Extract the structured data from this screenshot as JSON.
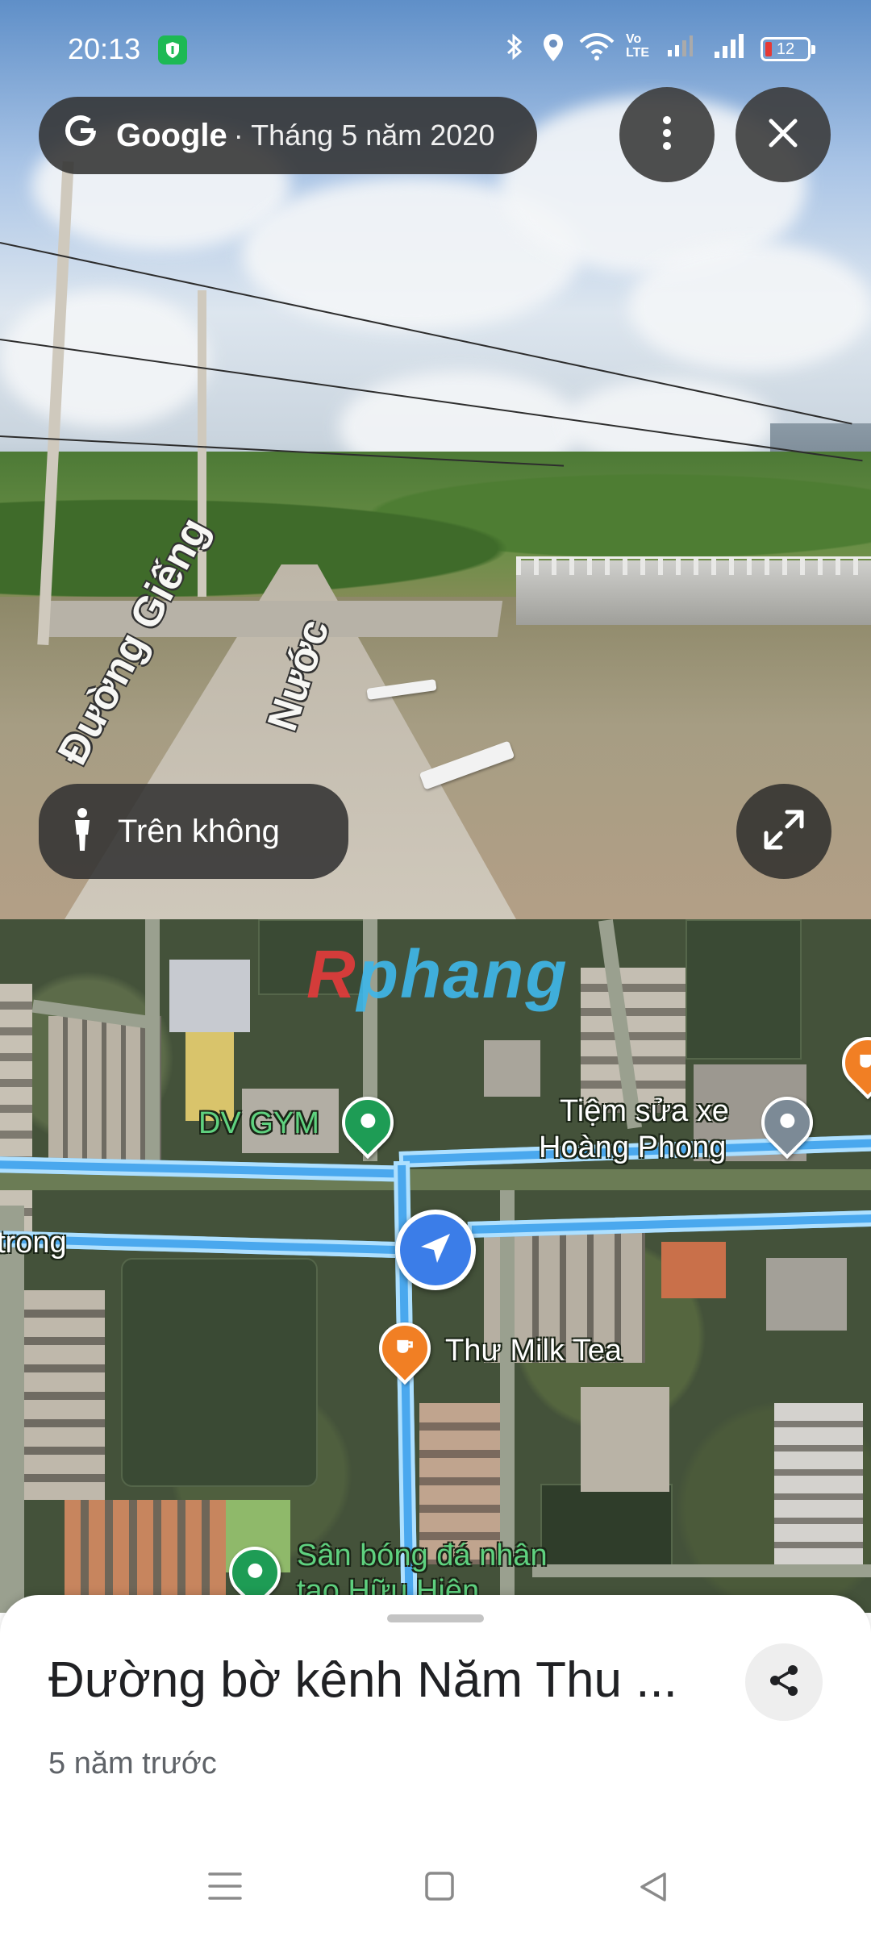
{
  "status_bar": {
    "time": "20:13",
    "battery": "12"
  },
  "street_view": {
    "source_brand": "Google",
    "capture_date": "· Tháng 5 năm 2020",
    "aerial_label": "Trên không",
    "road_label_1": "Đường Giếng",
    "road_label_2": "Nước"
  },
  "map": {
    "watermark": {
      "part1": "R",
      "part2": "phang"
    },
    "street_label_left": "trong",
    "pins": [
      {
        "label": "DV GYM",
        "type": "place",
        "color": "#1e9c55"
      },
      {
        "label_line1": "Tiệm sửa xe",
        "label_line2": "Hoàng Phong",
        "type": "service",
        "color": "#7c8a96"
      },
      {
        "label": "Thư Milk Tea",
        "type": "cafe",
        "color": "#f17f24"
      },
      {
        "label_line1": "Sân bóng đá nhân",
        "label_line2": "tạo Hữu Hiện",
        "type": "place",
        "color": "#1e9c55"
      }
    ]
  },
  "place": {
    "title": "Đường bờ kênh Năm Thu ...",
    "subtitle": "5 năm trước"
  },
  "colors": {
    "route": "#4aa8ee",
    "nav_dot": "#3b7de8",
    "pill_bg": "#323232"
  },
  "icons": [
    "shield-icon",
    "bluetooth-icon",
    "location-icon",
    "wifi-icon",
    "signal-icon",
    "battery-icon",
    "google-g-icon",
    "more-vert-icon",
    "close-icon",
    "person-icon",
    "expand-icon",
    "share-icon",
    "menu-icon",
    "home-square-icon",
    "back-triangle-icon"
  ]
}
